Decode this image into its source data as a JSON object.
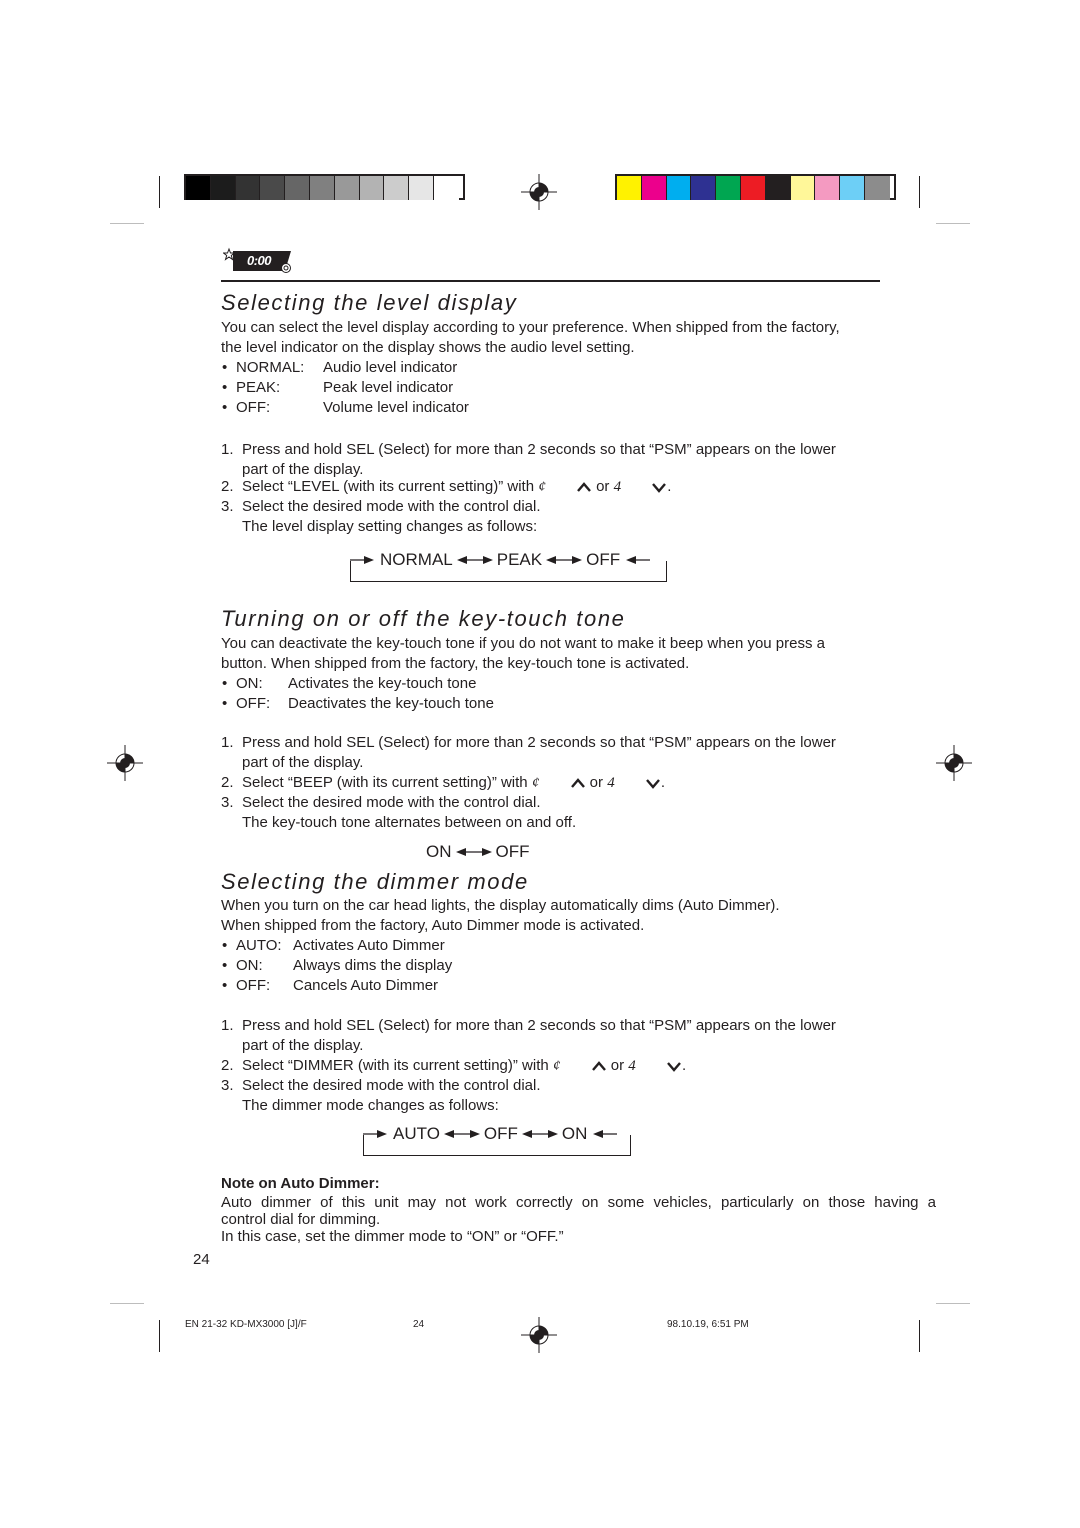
{
  "registration": {
    "grayscale_swatches": [
      "#000000",
      "#1c1c1c",
      "#333333",
      "#4a4a4a",
      "#666666",
      "#808080",
      "#999999",
      "#b3b3b3",
      "#cccccc",
      "#e6e6e6",
      "#ffffff"
    ],
    "color_swatches": [
      "#fff200",
      "#ec008c",
      "#00aeef",
      "#2e3192",
      "#00a651",
      "#ed1c24",
      "#231f20",
      "#fff799",
      "#f49ac1",
      "#6dcff6",
      "#8c8c8c"
    ]
  },
  "header_icon": {
    "name": "clock-settings-icon",
    "display_text": "0:00"
  },
  "sections": {
    "level": {
      "title": "Selecting the level display",
      "intro_line1": "You can select the level display according to your preference. When shipped from the factory,",
      "intro_line2": "the level indicator on the display shows the audio level setting.",
      "options": [
        {
          "key": "NORMAL:",
          "desc": "Audio level indicator"
        },
        {
          "key": "PEAK:",
          "desc": "Peak level indicator"
        },
        {
          "key": "OFF:",
          "desc": "Volume level indicator"
        }
      ],
      "steps": [
        {
          "num": "1.",
          "line1": "Press and hold SEL (Select) for more than 2 seconds so that “PSM” appears on the lower",
          "line2": "part of the display."
        },
        {
          "num": "2.",
          "before": "Select “LEVEL (with its current setting)” with",
          "sym1": "¢",
          "or": "or",
          "sym2": "4",
          "after": "."
        },
        {
          "num": "3.",
          "line1": "Select the desired mode with the control dial.",
          "line2": "The level display setting changes as follows:"
        }
      ],
      "flow": [
        "NORMAL",
        "PEAK",
        "OFF"
      ]
    },
    "beep": {
      "title": "Turning on or off the key-touch tone",
      "intro_line1": "You can deactivate the key-touch tone if you do not want to make it beep when you press a",
      "intro_line2": "button. When shipped from the factory, the key-touch tone is activated.",
      "options": [
        {
          "key": "ON:",
          "desc": "Activates the key-touch tone"
        },
        {
          "key": "OFF:",
          "desc": "Deactivates the key-touch tone"
        }
      ],
      "steps": [
        {
          "num": "1.",
          "line1": "Press and hold SEL (Select) for more than 2 seconds so that “PSM” appears on the lower",
          "line2": "part of the display."
        },
        {
          "num": "2.",
          "before": "Select “BEEP (with its current setting)” with",
          "sym1": "¢",
          "or": "or",
          "sym2": "4",
          "after": "."
        },
        {
          "num": "3.",
          "line1": "Select the desired mode with the control dial.",
          "line2": "The key-touch tone alternates between on and off."
        }
      ],
      "flow": [
        "ON",
        "OFF"
      ]
    },
    "dimmer": {
      "title": "Selecting the dimmer mode",
      "intro_line1": "When you turn on the car head lights, the display automatically dims (Auto Dimmer).",
      "intro_line2": "When shipped from the factory, Auto Dimmer mode is activated.",
      "options": [
        {
          "key": "AUTO:",
          "desc": "Activates Auto Dimmer"
        },
        {
          "key": "ON:",
          "desc": "Always dims the display"
        },
        {
          "key": "OFF:",
          "desc": "Cancels Auto Dimmer"
        }
      ],
      "steps": [
        {
          "num": "1.",
          "line1": "Press and hold SEL (Select) for more than 2 seconds so that “PSM” appears on the lower",
          "line2": "part of the display."
        },
        {
          "num": "2.",
          "before": "Select “DIMMER (with its current setting)” with",
          "sym1": "¢",
          "or": "or",
          "sym2": "4",
          "after": "."
        },
        {
          "num": "3.",
          "line1": "Select the desired mode with the control dial.",
          "line2": "The dimmer mode changes as follows:"
        }
      ],
      "flow": [
        "AUTO",
        "OFF",
        "ON"
      ]
    }
  },
  "note": {
    "heading": "Note on Auto Dimmer:",
    "line1": "Auto dimmer of this unit may not work correctly on some vehicles, particularly on those having a",
    "line2": "control dial for dimming.",
    "line3": "In this case, set the dimmer mode to “ON” or “OFF.”"
  },
  "page_number": "24",
  "footer": {
    "left": "EN  21-32  KD-MX3000 [J]/F",
    "center": "24",
    "right": "98.10.19, 6:51 PM"
  }
}
